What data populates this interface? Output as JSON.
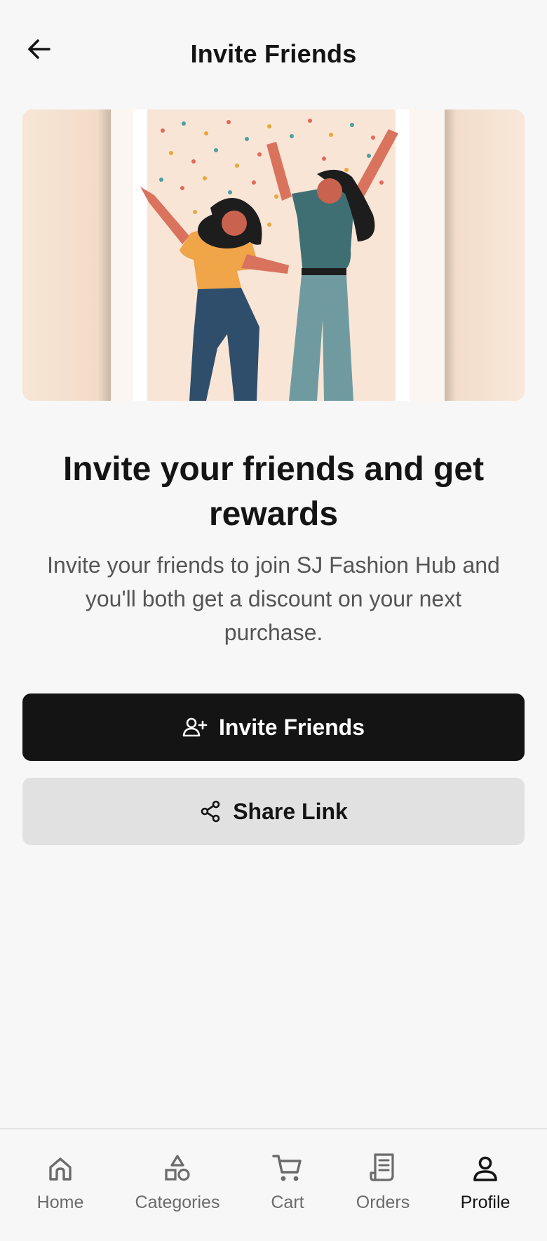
{
  "header": {
    "title": "Invite Friends"
  },
  "hero": {
    "headline": "Invite your friends and get rewards"
  },
  "description": "Invite your friends to join SJ Fashion Hub and you'll both get a discount on your next purchase.",
  "actions": {
    "invite_label": "Invite Friends",
    "share_label": "Share Link"
  },
  "bottom_nav": {
    "items": [
      {
        "label": "Home",
        "icon": "home-icon"
      },
      {
        "label": "Categories",
        "icon": "categories-icon"
      },
      {
        "label": "Cart",
        "icon": "cart-icon"
      },
      {
        "label": "Orders",
        "icon": "orders-icon"
      },
      {
        "label": "Profile",
        "icon": "profile-icon",
        "active": true
      }
    ]
  },
  "colors": {
    "primary_button": "#141414",
    "secondary_button": "#e1e1e1",
    "background": "#f7f7f7",
    "muted_text": "#6b6b6b"
  }
}
